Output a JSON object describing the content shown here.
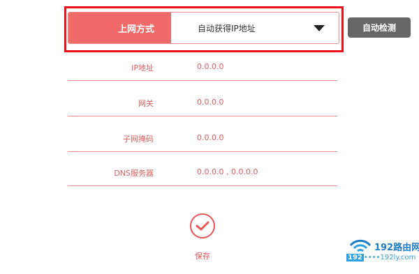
{
  "connection": {
    "label": "上网方式",
    "selected_value": "自动获得IP地址",
    "auto_detect_label": "自动检测"
  },
  "fields": [
    {
      "label": "IP地址",
      "value": "0.0.0.0"
    },
    {
      "label": "网关",
      "value": "0.0.0.0"
    },
    {
      "label": "子网掩码",
      "value": "0.0.0.0"
    },
    {
      "label": "DNS服务器",
      "value": "0.0.0.0 , 0.0.0.0"
    }
  ],
  "save": {
    "label": "保存"
  },
  "watermark": {
    "brand": "192路由网",
    "domain_num": "192",
    "domain_rest": "192ly.com"
  },
  "colors": {
    "accent": "#f16a6a",
    "highlight": "#e8111a",
    "button_gray": "#666666"
  }
}
